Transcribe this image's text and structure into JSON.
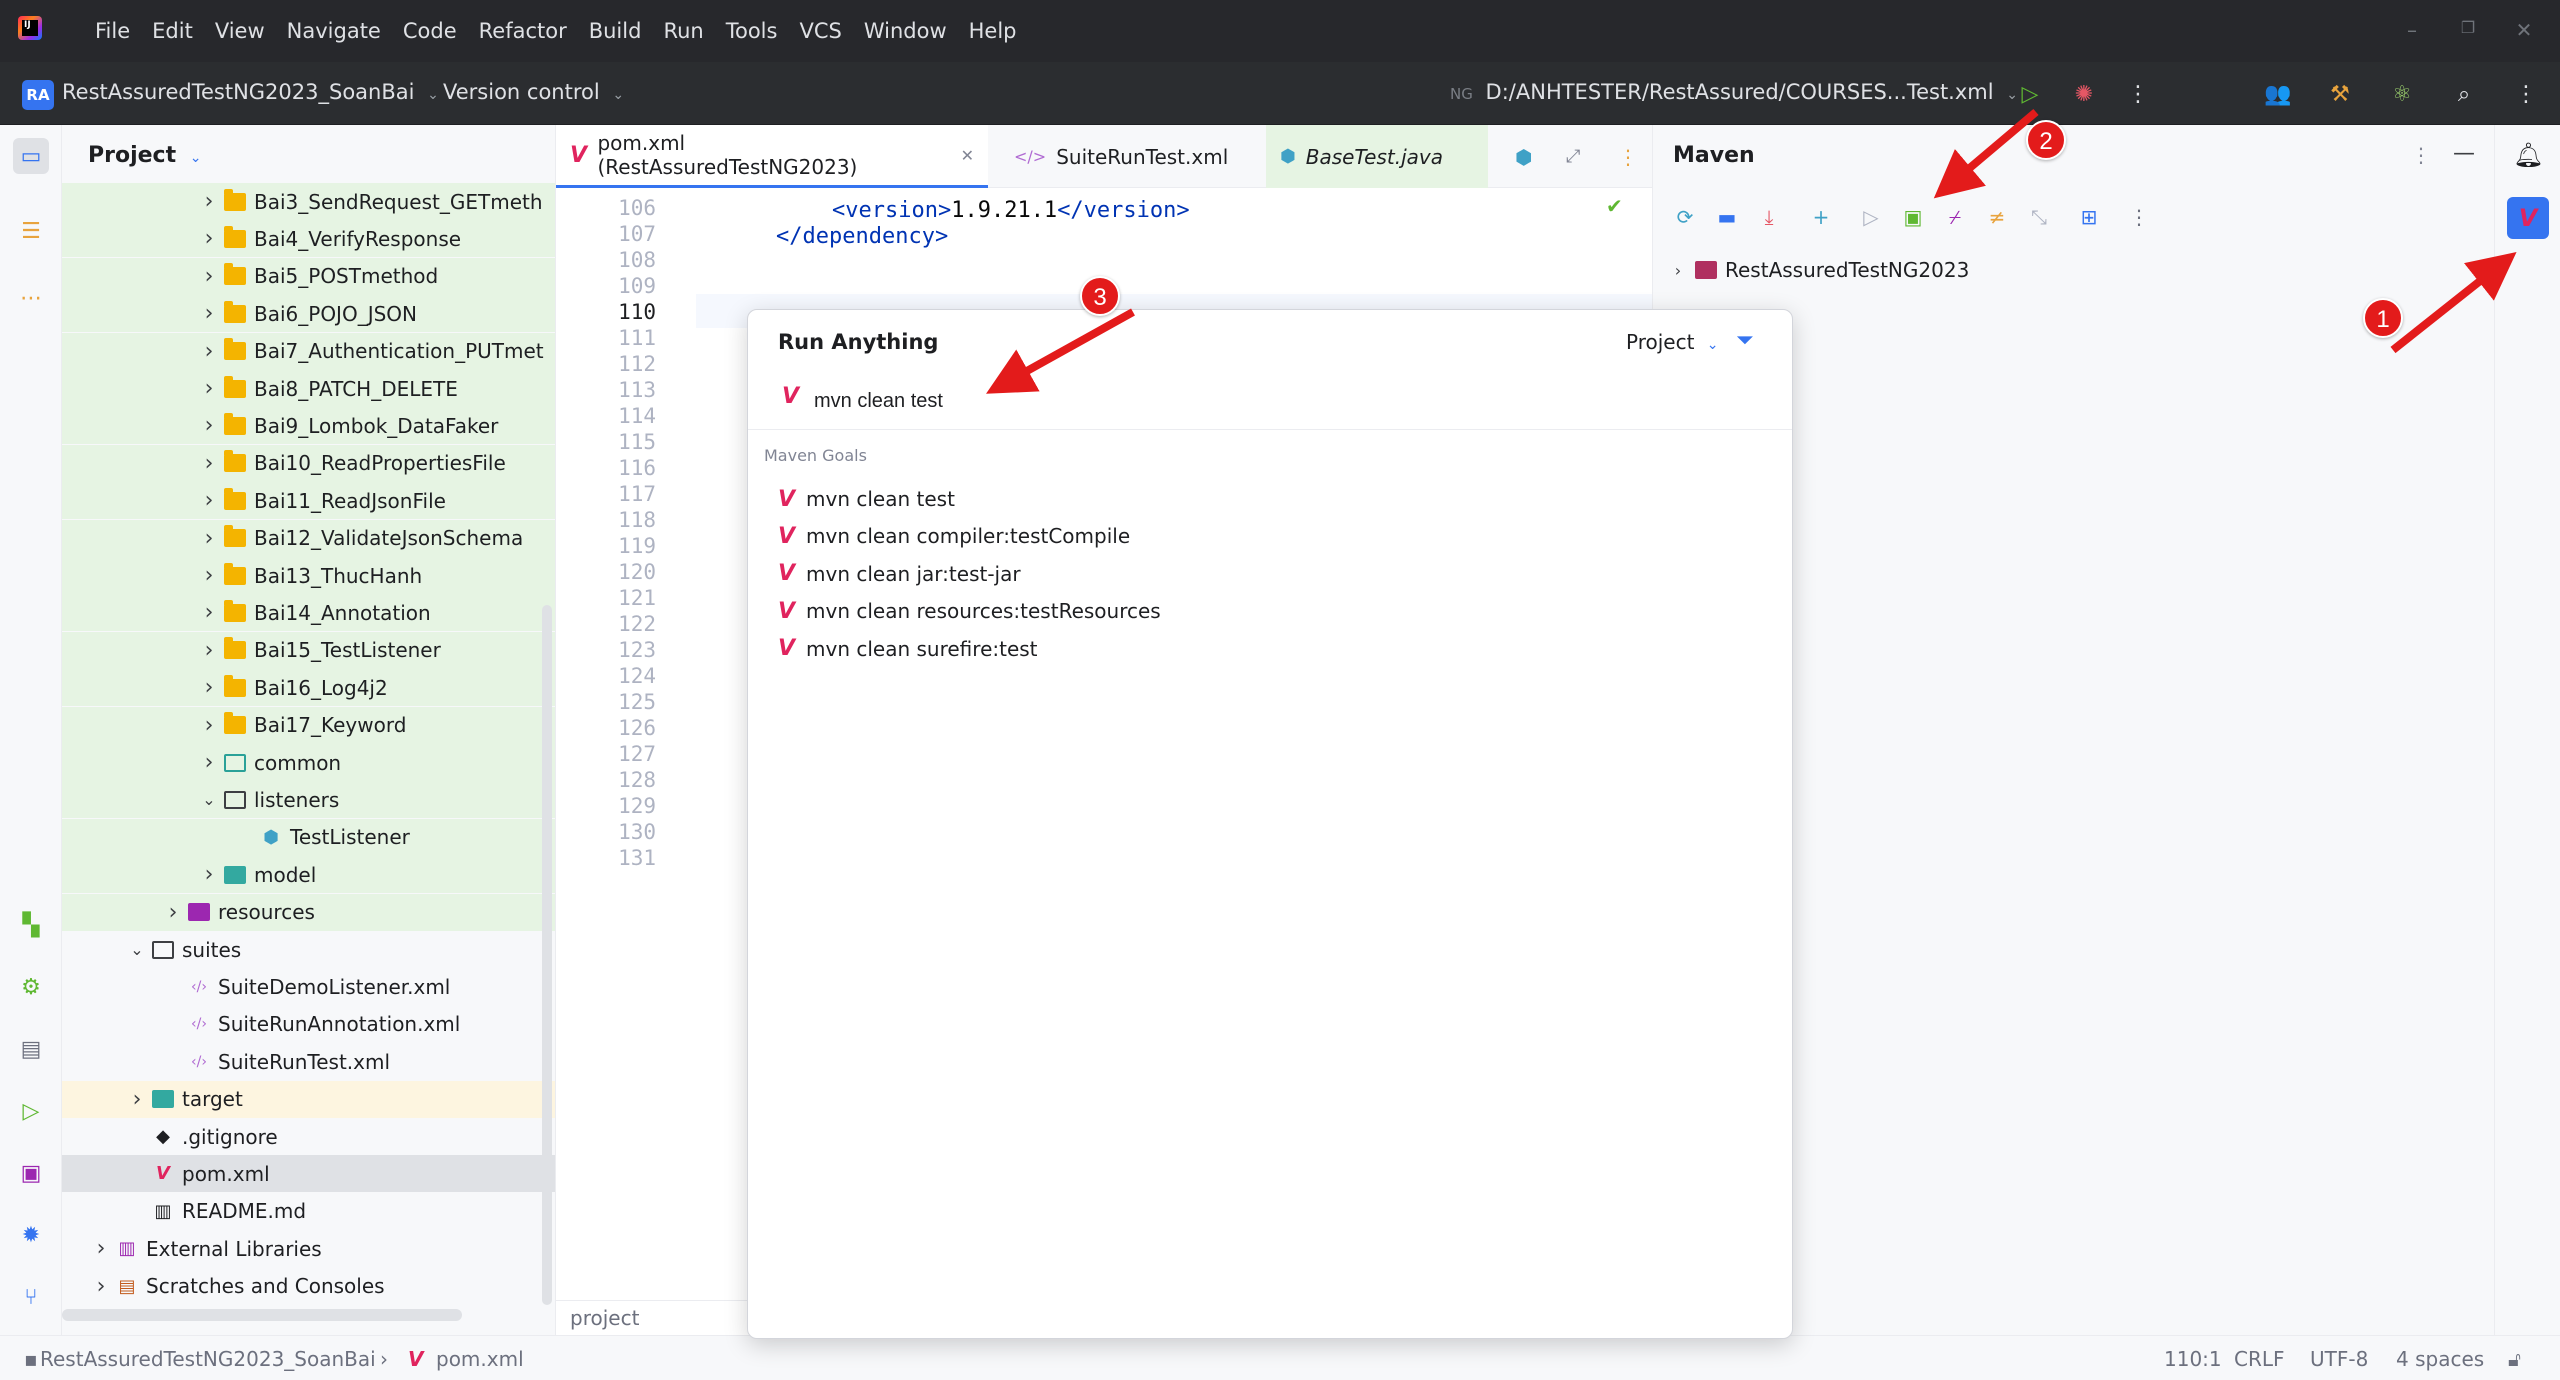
{
  "menu": [
    "File",
    "Edit",
    "View",
    "Navigate",
    "Code",
    "Refactor",
    "Build",
    "Run",
    "Tools",
    "VCS",
    "Window",
    "Help"
  ],
  "toolbar": {
    "project_badge": "RA",
    "project_name": "RestAssuredTestNG2023_SoanBai",
    "vcs_label": "Version control",
    "run_config": "D:/ANHTESTER/RestAssured/COURSES...Test.xml"
  },
  "project_panel": {
    "title": "Project",
    "items": [
      {
        "label": "Bai3_SendRequest_GETmeth",
        "type": "folder",
        "indent": 2,
        "expanded": false,
        "bg": "green"
      },
      {
        "label": "Bai4_VerifyResponse",
        "type": "folder",
        "indent": 2,
        "expanded": false,
        "bg": "green"
      },
      {
        "label": "Bai5_POSTmethod",
        "type": "folder",
        "indent": 2,
        "expanded": false,
        "bg": "green"
      },
      {
        "label": "Bai6_POJO_JSON",
        "type": "folder",
        "indent": 2,
        "expanded": false,
        "bg": "green"
      },
      {
        "label": "Bai7_Authentication_PUTmet",
        "type": "folder",
        "indent": 2,
        "expanded": false,
        "bg": "green"
      },
      {
        "label": "Bai8_PATCH_DELETE",
        "type": "folder",
        "indent": 2,
        "expanded": false,
        "bg": "green"
      },
      {
        "label": "Bai9_Lombok_DataFaker",
        "type": "folder",
        "indent": 2,
        "expanded": false,
        "bg": "green"
      },
      {
        "label": "Bai10_ReadPropertiesFile",
        "type": "folder",
        "indent": 2,
        "expanded": false,
        "bg": "green"
      },
      {
        "label": "Bai11_ReadJsonFile",
        "type": "folder",
        "indent": 2,
        "expanded": false,
        "bg": "green"
      },
      {
        "label": "Bai12_ValidateJsonSchema",
        "type": "folder",
        "indent": 2,
        "expanded": false,
        "bg": "green"
      },
      {
        "label": "Bai13_ThucHanh",
        "type": "folder",
        "indent": 2,
        "expanded": false,
        "bg": "green"
      },
      {
        "label": "Bai14_Annotation",
        "type": "folder",
        "indent": 2,
        "expanded": false,
        "bg": "green"
      },
      {
        "label": "Bai15_TestListener",
        "type": "folder",
        "indent": 2,
        "expanded": false,
        "bg": "green"
      },
      {
        "label": "Bai16_Log4j2",
        "type": "folder",
        "indent": 2,
        "expanded": false,
        "bg": "green"
      },
      {
        "label": "Bai17_Keyword",
        "type": "folder",
        "indent": 2,
        "expanded": false,
        "bg": "green"
      },
      {
        "label": "common",
        "type": "folder-teal",
        "indent": 2,
        "expanded": false,
        "bg": "green"
      },
      {
        "label": "listeners",
        "type": "folder-outline-blue",
        "indent": 2,
        "expanded": true,
        "bg": "green"
      },
      {
        "label": "TestListener",
        "type": "class",
        "indent": 3,
        "expanded": null,
        "bg": "green"
      },
      {
        "label": "model",
        "type": "folder-tealfill",
        "indent": 2,
        "expanded": false,
        "bg": "green"
      },
      {
        "label": "resources",
        "type": "folder-purple",
        "indent": 1,
        "expanded": false,
        "bg": "green"
      },
      {
        "label": "suites",
        "type": "folder-outline",
        "indent": 0,
        "expanded": true,
        "bg": "none"
      },
      {
        "label": "SuiteDemoListener.xml",
        "type": "xml",
        "indent": 1,
        "expanded": null,
        "bg": "none"
      },
      {
        "label": "SuiteRunAnnotation.xml",
        "type": "xml",
        "indent": 1,
        "expanded": null,
        "bg": "none"
      },
      {
        "label": "SuiteRunTest.xml",
        "type": "xml",
        "indent": 1,
        "expanded": null,
        "bg": "none"
      },
      {
        "label": "target",
        "type": "folder-tealfill",
        "indent": 0,
        "expanded": false,
        "bg": "yellow"
      },
      {
        "label": ".gitignore",
        "type": "git",
        "indent": 0,
        "expanded": null,
        "bg": "none"
      },
      {
        "label": "pom.xml",
        "type": "maven",
        "indent": 0,
        "expanded": null,
        "bg": "selected"
      },
      {
        "label": "README.md",
        "type": "md",
        "indent": 0,
        "expanded": null,
        "bg": "none"
      },
      {
        "label": "External Libraries",
        "type": "libs",
        "indent": -1,
        "expanded": false,
        "bg": "none"
      },
      {
        "label": "Scratches and Consoles",
        "type": "scratch",
        "indent": -1,
        "expanded": false,
        "bg": "none"
      }
    ]
  },
  "editor": {
    "tabs": [
      {
        "label": "pom.xml (RestAssuredTestNG2023)",
        "active": true,
        "icon": "maven-icon"
      },
      {
        "label": "SuiteRunTest.xml",
        "active": false,
        "icon": "xml-icon"
      },
      {
        "label": "BaseTest.java",
        "active": false,
        "icon": "java-class-icon"
      }
    ],
    "line_numbers": [
      "106",
      "107",
      "108",
      "109",
      "110",
      "111",
      "112",
      "113",
      "114",
      "115",
      "116",
      "117",
      "118",
      "119",
      "120",
      "121",
      "122",
      "123",
      "124",
      "125",
      "126",
      "127",
      "128",
      "129",
      "130",
      "131"
    ],
    "current_line": "110",
    "code": [
      {
        "line": "106",
        "open_tag": "<version>",
        "text": "1.9.21.1",
        "close_tag": "</version>",
        "indent": 2
      },
      {
        "line": "107",
        "open_tag": "</dependency>",
        "text": "",
        "close_tag": "",
        "indent": 1
      }
    ],
    "footer_crumb": "project"
  },
  "maven": {
    "title": "Maven",
    "root_project": "RestAssuredTestNG2023"
  },
  "run_anything": {
    "title": "Run Anything",
    "scope": "Project",
    "input_value": "mvn clean test",
    "group_label": "Maven Goals",
    "items": [
      "mvn clean test",
      "mvn clean compiler:testCompile",
      "mvn clean jar:test-jar",
      "mvn clean resources:testResources",
      "mvn clean surefire:test"
    ]
  },
  "statusbar": {
    "breadcrumb_project": "RestAssuredTestNG2023_SoanBai",
    "breadcrumb_file": "pom.xml",
    "position": "110:1",
    "line_sep": "CRLF",
    "encoding": "UTF-8",
    "indent": "4 spaces"
  },
  "annotations": {
    "badge1": "1",
    "badge2": "2",
    "badge3": "3",
    "arrow_color": "#e31b1b"
  }
}
